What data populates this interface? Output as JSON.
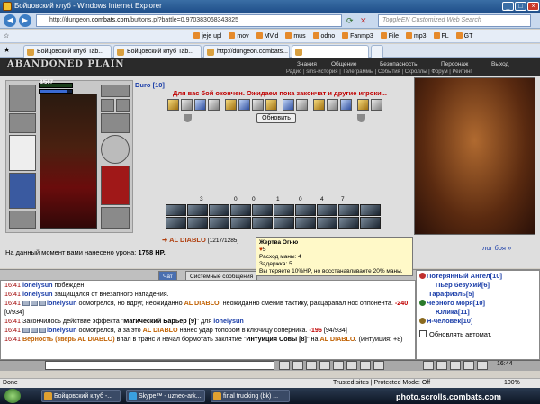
{
  "window": {
    "title": "Бойцовский клуб - Windows Internet Explorer"
  },
  "browser": {
    "url_prefix": "http://dungeon.",
    "url_domain": "combats.com",
    "url_rest": "/buttons.pl?battle=0.970383068343825",
    "search_placeholder": "ToggleEN Customized Web Search",
    "favorites": [
      "jeje upl",
      "mov",
      "MVid",
      "mus",
      "odno",
      "Fanmp3",
      "File",
      "mp3",
      "FL",
      "GT"
    ],
    "tabs": [
      "Бойцовский клуб Tab...",
      "Бойцовский клуб Tab...",
      "http://dungeon.combats..."
    ],
    "status_left": "Done",
    "status_right": "Trusted sites | Protected Mode: Off",
    "zoom": "100%"
  },
  "game": {
    "logo": "ABANDONED PLAIN",
    "menu_top": [
      "Знания",
      "Общение",
      "Безопасность",
      "Персонаж",
      "Выход"
    ],
    "menu_bottom": "Радио | sms-история | Телеграммы | События | Скроллы | Форум | Рейтинг",
    "player": {
      "name": "Duro [10]",
      "hp_text": "8/567",
      "hp_fraction": 0.014,
      "mp_fraction": 0.85
    },
    "fight_message": "Для вас бой окончен. Ожидаем пока закончат и другие игроки...",
    "refresh_button": "Обновить",
    "counts": [
      "3",
      "0",
      "0",
      "1",
      "0",
      "4",
      "7"
    ],
    "opponent": {
      "name": "AL DIABLO",
      "hp": "[1217/1285]"
    },
    "damage_label": "На данный момент вами нанесено урона:",
    "damage_value": "1758 HP.",
    "battle_log_link": "лог боя »",
    "tooltip": {
      "title": "Жертва Огню",
      "level": "5",
      "lines": [
        "Расход маны: 4",
        "Задержка: 5",
        "Вы теряете 10%HP, но восстанавливаете 20% маны."
      ]
    }
  },
  "chat": {
    "tabs": [
      "Чат",
      "Системные сообщения"
    ],
    "log": [
      {
        "time": "16:41",
        "parts": [
          {
            "c": "nm",
            "t": "lonelysun"
          },
          {
            "c": "",
            "t": " побежден"
          }
        ]
      },
      {
        "time": "16:41",
        "parts": [
          {
            "c": "nm",
            "t": "lonelysun"
          },
          {
            "c": "",
            "t": " защищался от внезапного нападения."
          }
        ]
      },
      {
        "time": "16:41",
        "pills": true,
        "parts": [
          {
            "c": "nm",
            "t": "lonelysun"
          },
          {
            "c": "",
            "t": " осмотрелся, но вдруг, неожиданно "
          },
          {
            "c": "en",
            "t": "AL DIABLO"
          },
          {
            "c": "",
            "t": ", неожиданно сменив тактику, расцарапал нос оппонента. "
          },
          {
            "c": "dm",
            "t": "-240"
          },
          {
            "c": "",
            "t": " [0/934]"
          }
        ]
      },
      {
        "time": "16:41",
        "parts": [
          {
            "c": "",
            "t": "Закончилось действие эффекта \""
          },
          {
            "c": "b",
            "t": "Магический Барьер [9]"
          },
          {
            "c": "",
            "t": "\" для "
          },
          {
            "c": "nm",
            "t": "lonelysun"
          }
        ]
      },
      {
        "time": "16:41",
        "pills": true,
        "parts": [
          {
            "c": "nm",
            "t": "lonelysun"
          },
          {
            "c": "",
            "t": " осмотрелся, а за это "
          },
          {
            "c": "en",
            "t": "AL DIABLO"
          },
          {
            "c": "",
            "t": " нанес удар топором в ключицу соперника. "
          },
          {
            "c": "dm",
            "t": "-196"
          },
          {
            "c": "",
            "t": " [94/934]"
          }
        ]
      },
      {
        "time": "16:41",
        "parts": [
          {
            "c": "en",
            "t": "Верность (зверь AL DIABLO)"
          },
          {
            "c": "",
            "t": " впал в транс и начал бормотать заклятие \""
          },
          {
            "c": "b",
            "t": "Интуиция Совы [8]"
          },
          {
            "c": "",
            "t": "\" на "
          },
          {
            "c": "en",
            "t": "AL DIABLO"
          },
          {
            "c": "",
            "t": ". (Интуиция: +8)"
          }
        ]
      }
    ]
  },
  "online": {
    "users": [
      "Потерянный Ангел[10]",
      "Пьер безухий[6]",
      "Тарафиэль[5]",
      "Черного моря[10]",
      "Юлика[11]",
      "Я-человек[10]"
    ],
    "auto_update": "Обновлять автомат."
  },
  "clock": "16:44",
  "taskbar": {
    "items": [
      "Бойцовский клуб -...",
      "Skype™ - uzneo-ark...",
      "final trucking (bk) ..."
    ]
  },
  "watermark": "photo.scrolls.combats.com"
}
